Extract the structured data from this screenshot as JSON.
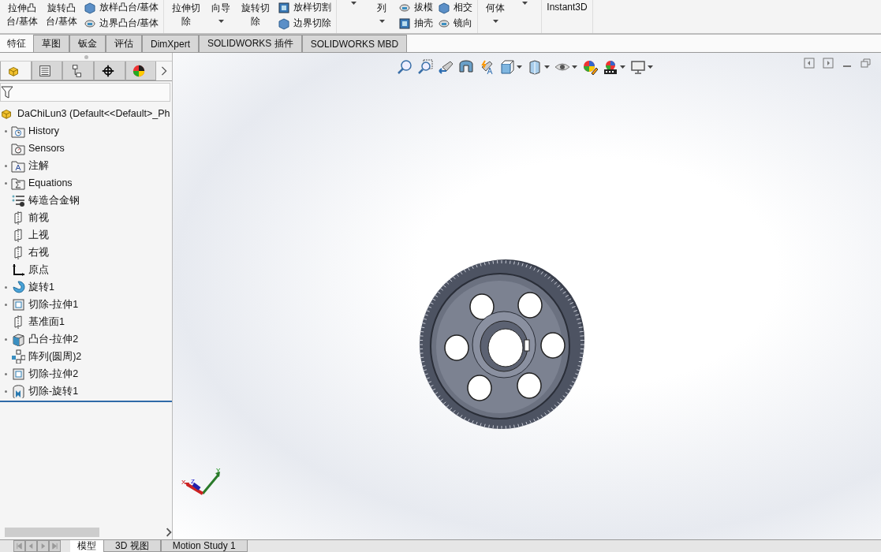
{
  "ribbon": {
    "groups": [
      {
        "items": [
          {
            "kind": "big",
            "label": "拉伸凸台/基体"
          },
          {
            "kind": "big",
            "label": "旋转凸台/基体"
          },
          {
            "kind": "column",
            "entries": [
              "放样凸台/基体",
              "边界凸台/基体"
            ]
          }
        ]
      },
      {
        "items": [
          {
            "kind": "big",
            "label": "拉伸切除"
          },
          {
            "kind": "dropdown",
            "label": "向导"
          },
          {
            "kind": "big",
            "label": "旋转切除"
          },
          {
            "kind": "column",
            "entries": [
              "放样切割",
              "边界切除"
            ]
          }
        ]
      },
      {
        "items": [
          {
            "kind": "dropdown"
          },
          {
            "kind": "dropdown",
            "label": "列"
          },
          {
            "kind": "column",
            "entries": [
              "拔模",
              "抽壳"
            ]
          },
          {
            "kind": "column",
            "entries": [
              "相交",
              "镜向"
            ]
          }
        ]
      },
      {
        "items": [
          {
            "kind": "dropdown",
            "label": "何体"
          },
          {
            "kind": "dropdown"
          }
        ]
      },
      {
        "items": [
          {
            "kind": "big",
            "label": "Instant3D"
          }
        ]
      }
    ]
  },
  "tabs": [
    {
      "label": "特征",
      "selected": true
    },
    {
      "label": "草图",
      "selected": false
    },
    {
      "label": "钣金",
      "selected": false
    },
    {
      "label": "评估",
      "selected": false
    },
    {
      "label": "DimXpert",
      "selected": false
    },
    {
      "label": "SOLIDWORKS 插件",
      "selected": false
    },
    {
      "label": "SOLIDWORKS MBD",
      "selected": false
    }
  ],
  "panel_tabs": [
    {
      "kind": "features",
      "selected": true
    },
    {
      "kind": "properties",
      "selected": false
    },
    {
      "kind": "configurations",
      "selected": false
    },
    {
      "kind": "dimxpert",
      "selected": false
    },
    {
      "kind": "display",
      "selected": false
    }
  ],
  "tree": {
    "root": "DaChiLun3  (Default<<Default>_Ph",
    "items": [
      {
        "kind": "history",
        "label": "History",
        "expandable": true
      },
      {
        "kind": "sensors",
        "label": "Sensors",
        "expandable": false
      },
      {
        "kind": "annotations",
        "label": "注解",
        "expandable": true
      },
      {
        "kind": "equations",
        "label": "Equations",
        "expandable": true
      },
      {
        "kind": "material",
        "label": "铸造合金钢",
        "expandable": false
      },
      {
        "kind": "plane",
        "label": "前视",
        "expandable": false
      },
      {
        "kind": "plane",
        "label": "上视",
        "expandable": false
      },
      {
        "kind": "plane",
        "label": "右视",
        "expandable": false
      },
      {
        "kind": "origin",
        "label": "原点",
        "expandable": false
      },
      {
        "kind": "revolve",
        "label": "旋转1",
        "expandable": true
      },
      {
        "kind": "cut",
        "label": "切除-拉伸1",
        "expandable": true
      },
      {
        "kind": "plane",
        "label": "基准面1",
        "expandable": false
      },
      {
        "kind": "boss",
        "label": "凸台-拉伸2",
        "expandable": true
      },
      {
        "kind": "pattern",
        "label": "阵列(圆周)2",
        "expandable": false
      },
      {
        "kind": "cut",
        "label": "切除-拉伸2",
        "expandable": true
      },
      {
        "kind": "cutrevolve",
        "label": "切除-旋转1",
        "expandable": true
      }
    ]
  },
  "bottom_tabs": [
    {
      "label": "模型",
      "selected": true
    },
    {
      "label": "3D 视图",
      "selected": false
    },
    {
      "label": "Motion Study 1",
      "selected": false
    }
  ],
  "triad": {
    "x": "X",
    "y": "Y",
    "z": "Z"
  }
}
